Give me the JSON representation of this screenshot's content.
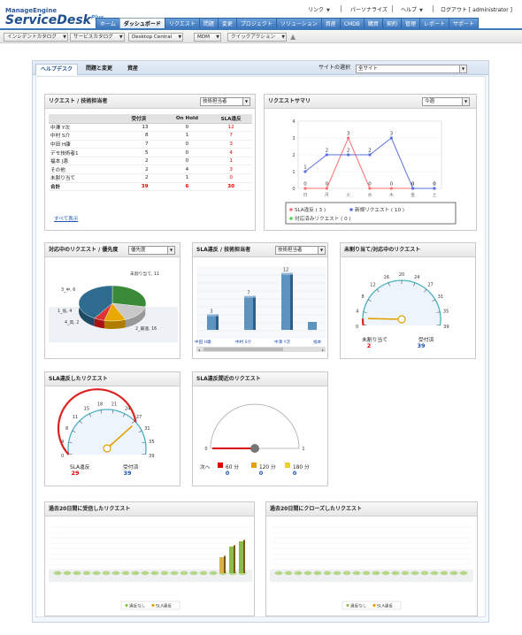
{
  "header": {
    "logo_top": "ManageEngine",
    "logo_main": "ServiceDesk",
    "logo_plus": "Plus",
    "links": [
      "リンク",
      "パーソナライズ",
      "ヘルプ",
      "ログアウト [ administrator ]"
    ],
    "nav": [
      "ホーム",
      "ダッシュボード",
      "リクエスト",
      "問題",
      "変更",
      "プロジェクト",
      "ソリューション",
      "資産",
      "CMDB",
      "購買",
      "契約",
      "管理",
      "レポート",
      "サポート"
    ],
    "active_nav": "ダッシュボード"
  },
  "toolbar": {
    "items": [
      "インシデントカタログ",
      "サービスカタログ",
      "Desktop Central",
      "MDM",
      "クイックアクション"
    ]
  },
  "panel": {
    "tabs": [
      "ヘルプデスク",
      "問題と変更",
      "資産"
    ],
    "site_label": "サイトの選択",
    "site_value": "全サイト"
  },
  "w_tech": {
    "title": "リクエスト / 技術担当者",
    "select": "技術担当者",
    "columns": [
      "",
      "受付済",
      "On Hold",
      "SLA違反"
    ],
    "rows": [
      [
        "中澤 Y次",
        "13",
        "0",
        "12"
      ],
      [
        "中村 S介",
        "8",
        "1",
        "7"
      ],
      [
        "中田 H康",
        "7",
        "0",
        "3"
      ],
      [
        "デモ技術者1",
        "5",
        "0",
        "4"
      ],
      [
        "福本 J恵",
        "2",
        "0",
        "1"
      ],
      [
        "その他",
        "2",
        "4",
        "3"
      ],
      [
        "未割り当て",
        "2",
        "1",
        "0"
      ]
    ],
    "total": [
      "合計",
      "39",
      "6",
      "30"
    ],
    "show_all": "すべて表示"
  },
  "w_summary": {
    "title": "リクエストサマリ",
    "select": "今週",
    "days": [
      "日",
      "月",
      "火",
      "水",
      "木",
      "金",
      "土"
    ],
    "y_ticks": [
      "0",
      "1",
      "2",
      "3",
      "4"
    ],
    "legend": [
      "SLA違反 ( 3 )",
      "新規リクエスト ( 10 )",
      "対応済みリクエスト ( 0 )"
    ],
    "colors": {
      "sla": "#ff6f6f",
      "new": "#5a6fe0",
      "done": "#55cc55"
    }
  },
  "w_priority": {
    "title": "対応中のリクエスト / 優先度",
    "select": "優先度",
    "labels": [
      "未割り当て, 11",
      "3_中, 6",
      "1_低, 4",
      "4_高, 2",
      "2_最速, 16"
    ]
  },
  "w_sla_tech": {
    "title": "SLA違反 / 技術担当者",
    "select": "技術担当者",
    "values": [
      "3",
      "7",
      "12"
    ],
    "names": [
      "中田 H康",
      "中村 S介",
      "中澤 Y次",
      "福本"
    ]
  },
  "w_unassigned": {
    "title": "未割り当て/対応中のリクエスト",
    "ticks": [
      "0",
      "4",
      "8",
      "12",
      "16",
      "20",
      "24",
      "27",
      "31",
      "35",
      "39"
    ],
    "labels": [
      "未割り当て",
      "受付済"
    ],
    "values": [
      "2",
      "39"
    ]
  },
  "w_sla_violated": {
    "title": "SLA違反したリクエスト",
    "ticks": [
      "0",
      "4",
      "8",
      "11",
      "15",
      "18",
      "21",
      "24",
      "27",
      "31",
      "35",
      "39"
    ],
    "labels": [
      "SLA違反",
      "受付済"
    ],
    "values": [
      "29",
      "39"
    ]
  },
  "w_sla_near": {
    "title": "SLA違反間近のリクエスト",
    "scale": [
      "0",
      "1"
    ],
    "next_label": "次へ",
    "legend": [
      "60 分",
      "120 分",
      "180 分"
    ],
    "values": [
      "0",
      "0",
      "0"
    ],
    "colors": {
      "60": "#dd0000",
      "120": "#e8a000",
      "180": "#f0d020"
    }
  },
  "w_received": {
    "title": "過去20日間に受信したリクエスト",
    "legend": [
      "違反なし",
      "SLA違反"
    ]
  },
  "w_closed": {
    "title": "過去20日間にクローズしたリクエスト",
    "legend": [
      "違反なし",
      "SLA違反"
    ]
  },
  "chart_data": [
    {
      "type": "line",
      "title": "リクエストサマリ",
      "categories": [
        "日",
        "月",
        "火",
        "水",
        "木",
        "金",
        "土"
      ],
      "ylim": [
        0,
        4
      ],
      "series": [
        {
          "name": "SLA違反",
          "values": [
            0,
            0,
            3,
            0,
            0,
            0,
            0
          ]
        },
        {
          "name": "新規リクエスト",
          "values": [
            1,
            2,
            2,
            2,
            3,
            0,
            0
          ]
        },
        {
          "name": "対応済みリクエスト",
          "values": [
            0,
            0,
            0,
            0,
            0,
            0,
            0
          ]
        }
      ]
    },
    {
      "type": "pie",
      "title": "対応中のリクエスト / 優先度",
      "categories": [
        "未割り当て",
        "3_中",
        "1_低",
        "4_高",
        "2_最速"
      ],
      "values": [
        11,
        6,
        4,
        2,
        16
      ]
    },
    {
      "type": "bar",
      "title": "SLA違反 / 技術担当者",
      "categories": [
        "中田 H康",
        "中村 S介",
        "中澤 Y次"
      ],
      "values": [
        3,
        7,
        12
      ]
    }
  ]
}
